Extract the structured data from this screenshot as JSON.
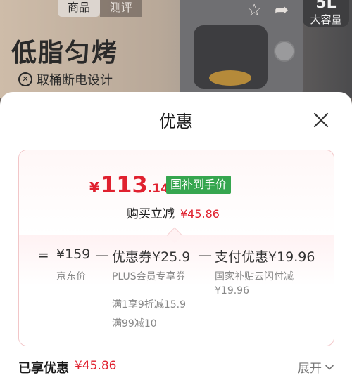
{
  "background": {
    "tabs": [
      "商品",
      "测评"
    ],
    "headline": "低脂匀烤",
    "feature": "取桶断电设计",
    "badge_number": "5L",
    "badge_text": "大容量",
    "icons": [
      "star-icon",
      "share-icon"
    ]
  },
  "sheet": {
    "title": "优惠",
    "close_icon": "close-icon"
  },
  "price": {
    "currency": "¥",
    "integer": "113",
    "decimal": ".14",
    "tag": "国补到手价",
    "reduce_label": "购买立减",
    "reduce_amount": "¥45.86",
    "accent_color": "#e0212f",
    "tag_color": "#36a64f"
  },
  "breakdown": {
    "equals": "=",
    "minus": "—",
    "terms": [
      {
        "value": "¥159",
        "notes": [
          "京东价"
        ]
      },
      {
        "value": "优惠券¥25.9",
        "notes": [
          "PLUS会员专享券",
          "满1享9折减15.9",
          "满99减10"
        ]
      },
      {
        "value": "支付优惠¥19.96",
        "notes": [
          "国家补贴云闪付减",
          "¥19.96"
        ]
      }
    ]
  },
  "footer": {
    "label": "已享优惠",
    "amount": "¥45.86",
    "expand_label": "展开"
  }
}
